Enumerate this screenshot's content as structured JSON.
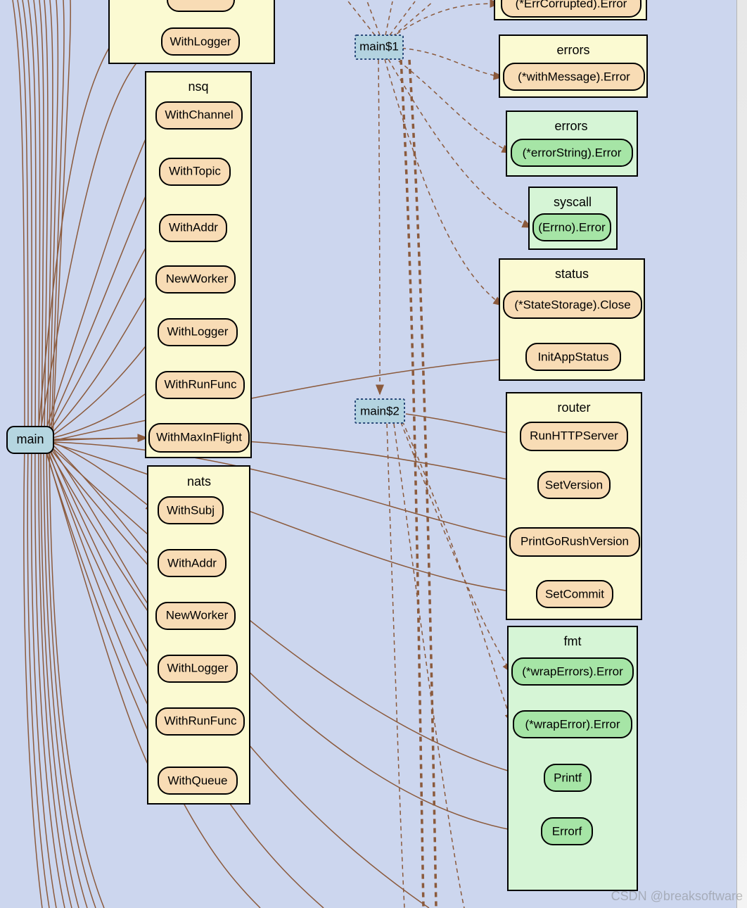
{
  "main": {
    "label": "main"
  },
  "closures": {
    "main1": "main$1",
    "main2": "main$2"
  },
  "pkg_top": {
    "name_hidden": "",
    "items": [
      "WithLogger"
    ]
  },
  "pkg_nsq": {
    "name": "nsq",
    "items": [
      "WithChannel",
      "WithTopic",
      "WithAddr",
      "NewWorker",
      "WithLogger",
      "WithRunFunc",
      "WithMaxInFlight"
    ]
  },
  "pkg_nats": {
    "name": "nats",
    "items": [
      "WithSubj",
      "WithAddr",
      "NewWorker",
      "WithLogger",
      "WithRunFunc",
      "WithQueue"
    ]
  },
  "pkg_errcorrupt": {
    "name_hidden": "",
    "items": [
      "(*ErrCorrupted).Error"
    ]
  },
  "pkg_errors": {
    "name": "errors",
    "items": [
      "(*withMessage).Error"
    ]
  },
  "pkg_errors2": {
    "name": "errors",
    "items": [
      "(*errorString).Error"
    ]
  },
  "pkg_syscall": {
    "name": "syscall",
    "items": [
      "(Errno).Error"
    ]
  },
  "pkg_status": {
    "name": "status",
    "items": [
      "(*StateStorage).Close",
      "InitAppStatus"
    ]
  },
  "pkg_router": {
    "name": "router",
    "items": [
      "RunHTTPServer",
      "SetVersion",
      "PrintGoRushVersion",
      "SetCommit"
    ]
  },
  "pkg_fmt": {
    "name": "fmt",
    "items": [
      "(*wrapErrors).Error",
      "(*wrapError).Error",
      "Printf",
      "Errorf"
    ]
  },
  "watermark": "CSDN @breaksoftware"
}
